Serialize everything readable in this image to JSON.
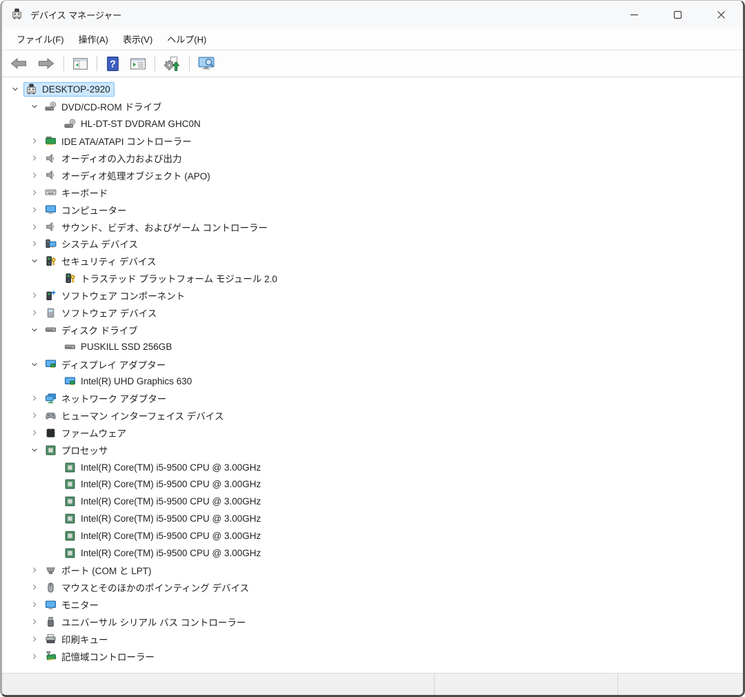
{
  "window": {
    "title": "デバイス マネージャー"
  },
  "menu": {
    "items": [
      "ファイル(F)",
      "操作(A)",
      "表示(V)",
      "ヘルプ(H)"
    ]
  },
  "toolbar": {
    "buttons": [
      "back",
      "forward",
      "show-hide-console-tree",
      "help",
      "properties",
      "scan-hardware-changes",
      "search-computer"
    ]
  },
  "tree": {
    "nodes": [
      {
        "label": "DESKTOP-2920",
        "level": 0,
        "state": "expanded",
        "icon": "computer",
        "selected": true
      },
      {
        "label": "DVD/CD-ROM ドライブ",
        "level": 1,
        "state": "expanded",
        "icon": "dvd-drive",
        "selected": false
      },
      {
        "label": "HL-DT-ST DVDRAM GHC0N",
        "level": 2,
        "state": "leaf",
        "icon": "dvd-drive",
        "selected": false
      },
      {
        "label": "IDE ATA/ATAPI コントローラー",
        "level": 1,
        "state": "collapsed",
        "icon": "ide-controller",
        "selected": false
      },
      {
        "label": "オーディオの入力および出力",
        "level": 1,
        "state": "collapsed",
        "icon": "audio",
        "selected": false
      },
      {
        "label": "オーディオ処理オブジェクト (APO)",
        "level": 1,
        "state": "collapsed",
        "icon": "audio",
        "selected": false
      },
      {
        "label": "キーボード",
        "level": 1,
        "state": "collapsed",
        "icon": "keyboard",
        "selected": false
      },
      {
        "label": "コンピューター",
        "level": 1,
        "state": "collapsed",
        "icon": "monitor",
        "selected": false
      },
      {
        "label": "サウンド、ビデオ、およびゲーム コントローラー",
        "level": 1,
        "state": "collapsed",
        "icon": "audio",
        "selected": false
      },
      {
        "label": "システム デバイス",
        "level": 1,
        "state": "collapsed",
        "icon": "system-devices",
        "selected": false
      },
      {
        "label": "セキュリティ デバイス",
        "level": 1,
        "state": "expanded",
        "icon": "security-device",
        "selected": false
      },
      {
        "label": "トラステッド プラットフォーム モジュール 2.0",
        "level": 2,
        "state": "leaf",
        "icon": "security-device",
        "selected": false
      },
      {
        "label": "ソフトウェア コンポーネント",
        "level": 1,
        "state": "collapsed",
        "icon": "software-component",
        "selected": false
      },
      {
        "label": "ソフトウェア デバイス",
        "level": 1,
        "state": "collapsed",
        "icon": "software-device",
        "selected": false
      },
      {
        "label": "ディスク ドライブ",
        "level": 1,
        "state": "expanded",
        "icon": "disk-drive",
        "selected": false
      },
      {
        "label": "PUSKILL SSD 256GB",
        "level": 2,
        "state": "leaf",
        "icon": "disk-drive",
        "selected": false
      },
      {
        "label": "ディスプレイ アダプター",
        "level": 1,
        "state": "expanded",
        "icon": "display-adapter",
        "selected": false
      },
      {
        "label": "Intel(R) UHD Graphics 630",
        "level": 2,
        "state": "leaf",
        "icon": "display-adapter",
        "selected": false
      },
      {
        "label": "ネットワーク アダプター",
        "level": 1,
        "state": "collapsed",
        "icon": "network-adapter",
        "selected": false
      },
      {
        "label": "ヒューマン インターフェイス デバイス",
        "level": 1,
        "state": "collapsed",
        "icon": "hid",
        "selected": false
      },
      {
        "label": "ファームウェア",
        "level": 1,
        "state": "collapsed",
        "icon": "firmware",
        "selected": false
      },
      {
        "label": "プロセッサ",
        "level": 1,
        "state": "expanded",
        "icon": "processor",
        "selected": false
      },
      {
        "label": "Intel(R) Core(TM) i5-9500 CPU @ 3.00GHz",
        "level": 2,
        "state": "leaf",
        "icon": "processor",
        "selected": false
      },
      {
        "label": "Intel(R) Core(TM) i5-9500 CPU @ 3.00GHz",
        "level": 2,
        "state": "leaf",
        "icon": "processor",
        "selected": false
      },
      {
        "label": "Intel(R) Core(TM) i5-9500 CPU @ 3.00GHz",
        "level": 2,
        "state": "leaf",
        "icon": "processor",
        "selected": false
      },
      {
        "label": "Intel(R) Core(TM) i5-9500 CPU @ 3.00GHz",
        "level": 2,
        "state": "leaf",
        "icon": "processor",
        "selected": false
      },
      {
        "label": "Intel(R) Core(TM) i5-9500 CPU @ 3.00GHz",
        "level": 2,
        "state": "leaf",
        "icon": "processor",
        "selected": false
      },
      {
        "label": "Intel(R) Core(TM) i5-9500 CPU @ 3.00GHz",
        "level": 2,
        "state": "leaf",
        "icon": "processor",
        "selected": false
      },
      {
        "label": "ポート (COM と LPT)",
        "level": 1,
        "state": "collapsed",
        "icon": "port",
        "selected": false
      },
      {
        "label": "マウスとそのほかのポインティング デバイス",
        "level": 1,
        "state": "collapsed",
        "icon": "mouse",
        "selected": false
      },
      {
        "label": "モニター",
        "level": 1,
        "state": "collapsed",
        "icon": "monitor",
        "selected": false
      },
      {
        "label": "ユニバーサル シリアル バス コントローラー",
        "level": 1,
        "state": "collapsed",
        "icon": "usb",
        "selected": false
      },
      {
        "label": "印刷キュー",
        "level": 1,
        "state": "collapsed",
        "icon": "printer",
        "selected": false
      },
      {
        "label": "記憶域コントローラー",
        "level": 1,
        "state": "collapsed",
        "icon": "storage-controller",
        "selected": false
      }
    ]
  },
  "statusbar": {
    "sections": [
      "",
      "",
      ""
    ]
  }
}
